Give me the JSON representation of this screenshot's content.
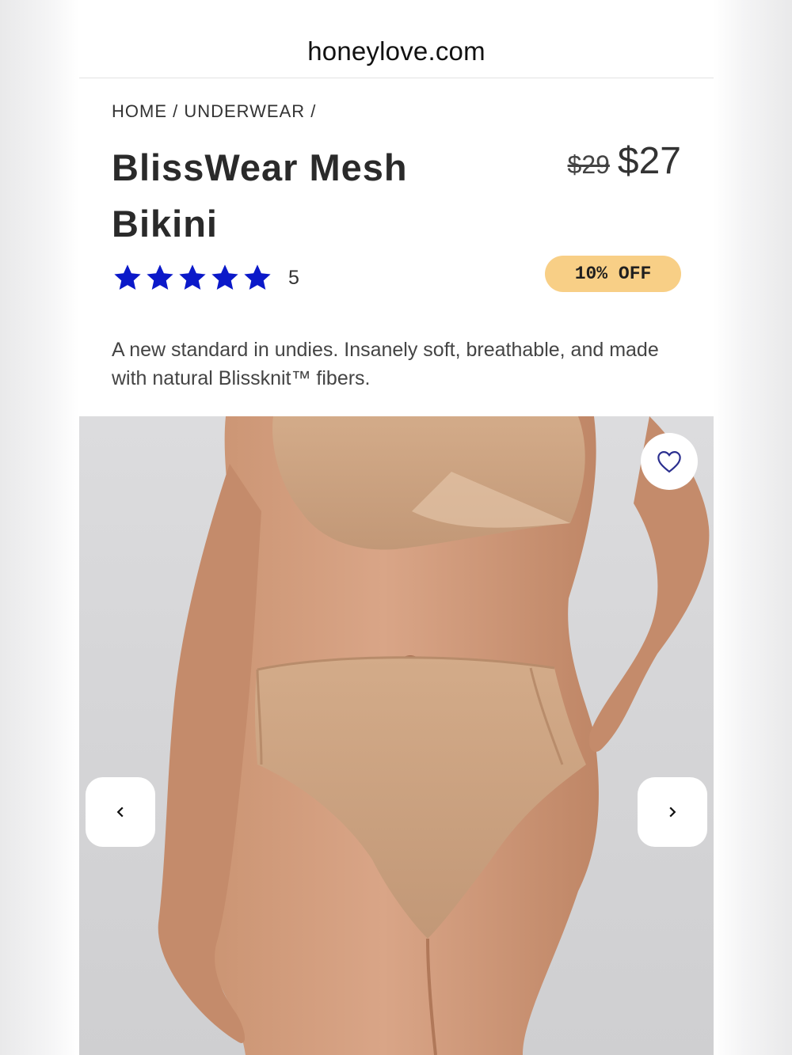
{
  "browser": {
    "url": "honeylove.com"
  },
  "product": {
    "breadcrumb": "HOME / UNDERWEAR /",
    "title": "BlissWear Mesh Bikini",
    "original_price": "$29",
    "sale_price": "$27",
    "rating": {
      "stars": 5,
      "count": "5"
    },
    "discount_badge": "10% OFF",
    "description": "A new standard in undies. Insanely soft, breathable, and made with natural Blissknit™ fibers."
  },
  "gallery": {
    "favorite_icon": "heart-outline-icon",
    "prev_icon": "chevron-left-icon",
    "next_icon": "chevron-right-icon"
  },
  "colors": {
    "star": "#0b19c9",
    "badge_bg": "#f8cf86",
    "heart": "#2b2f8f",
    "product_nude": "#c9a07f"
  }
}
